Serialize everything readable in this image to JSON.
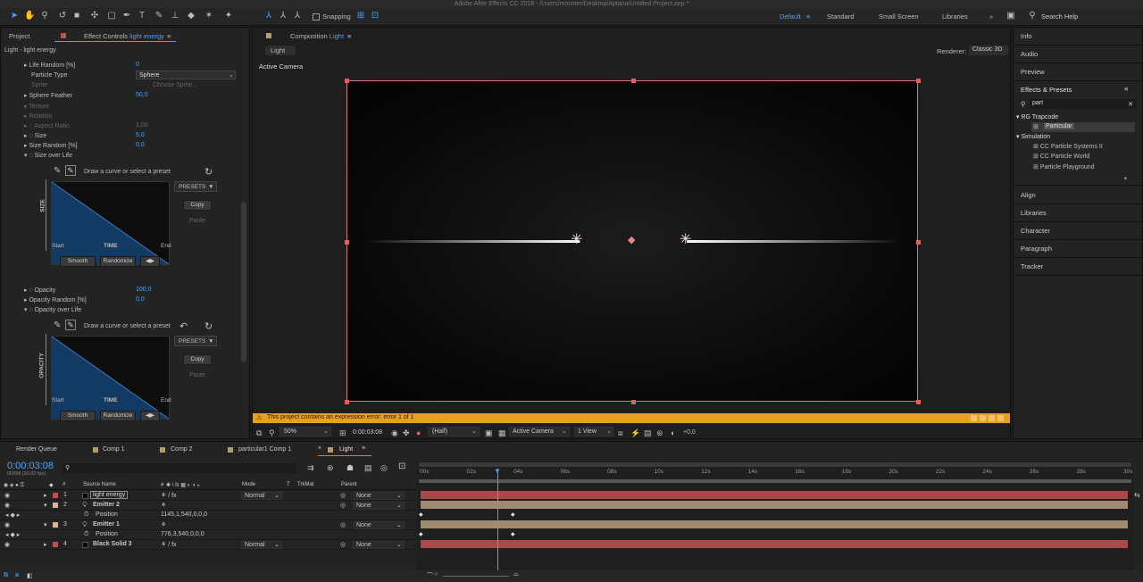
{
  "window": {
    "title": "Adobe After Effects CC 2018 - /Users/monster/Desktop/Aptana/Untitled Project.aep *"
  },
  "toolbar": {
    "snapping_label": "Snapping",
    "workspaces": [
      "Default",
      "Standard",
      "Small Screen",
      "Libraries"
    ],
    "search_placeholder": "Search Help"
  },
  "left_panel": {
    "tab_project": "Project",
    "tab_effect_prefix": "Effect Controls",
    "tab_effect_layer": "light energy",
    "header": "Light - light energy",
    "props": [
      {
        "label": "Life Random [%]",
        "value": "0"
      },
      {
        "label": "Particle Type",
        "value": "Sphere"
      },
      {
        "label": "Sprite",
        "value": "Choose Sprite..."
      },
      {
        "label": "Sphere Feather",
        "value": "50,0"
      },
      {
        "label": "Texture",
        "value": ""
      },
      {
        "label": "Rotation",
        "value": ""
      },
      {
        "label": "Aspect Ratio",
        "value": "1,00"
      },
      {
        "label": "Size",
        "value": "5,0"
      },
      {
        "label": "Size Random [%]",
        "value": "0,0"
      },
      {
        "label": "Size over Life",
        "value": ""
      }
    ],
    "curve_hint": "Draw a curve or select a preset",
    "presets_label": "PRESETS",
    "copy_label": "Copy",
    "paste_label": "Paste",
    "graph_start": "Start",
    "graph_time": "TIME",
    "graph_end": "End",
    "size_axis": "SIZE",
    "opacity_axis": "OPACITY",
    "smooth_label": "Smooth",
    "randomize_label": "Randomize",
    "props2": [
      {
        "label": "Opacity",
        "value": "100,0"
      },
      {
        "label": "Opacity Random [%]",
        "value": "0,0"
      },
      {
        "label": "Opacity over Life",
        "value": ""
      }
    ]
  },
  "composition": {
    "tab_prefix": "Composition",
    "tab_name": "Light",
    "sub_tab": "Light",
    "renderer_label": "Renderer:",
    "renderer_value": "Classic 3D",
    "active_camera": "Active Camera",
    "warning": "This project contains an expression error: error 1 of 1",
    "footer": {
      "zoom": "50%",
      "timecode": "0:00:03:08",
      "resolution": "(Half)",
      "camera": "Active Camera",
      "views": "1 View",
      "exposure": "+0,0"
    }
  },
  "right_panel": {
    "top_items": [
      "Info",
      "Audio",
      "Preview"
    ],
    "effects_title": "Effects & Presets",
    "search_value": "part",
    "groups": [
      {
        "name": "RG Trapcode",
        "items": [
          "Particular"
        ]
      },
      {
        "name": "Simulation",
        "items": [
          "CC Particle Systems II",
          "CC Particle World",
          "Particle Playground"
        ]
      }
    ],
    "bottom_items": [
      "Align",
      "Libraries",
      "Character",
      "Paragraph",
      "Tracker"
    ]
  },
  "timeline": {
    "tabs": [
      {
        "label": "Render Queue",
        "color": ""
      },
      {
        "label": "Comp 1",
        "color": "#b59a6a"
      },
      {
        "label": "Comp 2",
        "color": "#b59a6a"
      },
      {
        "label": "particular1 Comp 1",
        "color": "#b59a6a"
      },
      {
        "label": "Light",
        "color": "#b59a6a"
      }
    ],
    "timecode": "0:00:03:08",
    "fps": "00098 (30.00 fps)",
    "col_headers": {
      "source": "Source Name",
      "mode": "Mode",
      "t": "T",
      "trkmat": "TrkMat",
      "parent": "Parent"
    },
    "layers": [
      {
        "num": "1",
        "name": "light energy",
        "color": "#c84a4a",
        "mode": "Normal",
        "parent": "None"
      },
      {
        "num": "2",
        "name": "Emitter 2",
        "color": "#d4b890",
        "mode": "",
        "parent": "None"
      },
      {
        "num": "",
        "name": "Position",
        "color": "",
        "mode": "",
        "parent": "",
        "value": "1145,1,540,0,0,0"
      },
      {
        "num": "3",
        "name": "Emitter 1",
        "color": "#d4b890",
        "mode": "",
        "parent": "None"
      },
      {
        "num": "",
        "name": "Position",
        "color": "",
        "mode": "",
        "parent": "",
        "value": "776,3,540,0,0,0"
      },
      {
        "num": "4",
        "name": "Black Solid 3",
        "color": "#c84a4a",
        "mode": "Normal",
        "parent": "None"
      }
    ],
    "ruler": [
      "00s",
      "02s",
      "04s",
      "06s",
      "08s",
      "10s",
      "12s",
      "14s",
      "16s",
      "18s",
      "20s",
      "22s",
      "24s",
      "26s",
      "28s",
      "30s"
    ],
    "colors": {
      "red_bar": "#a94a4a",
      "tan_bar": "#a08a70",
      "accent": "#4aa3ff",
      "warning": "#e8a020"
    }
  }
}
